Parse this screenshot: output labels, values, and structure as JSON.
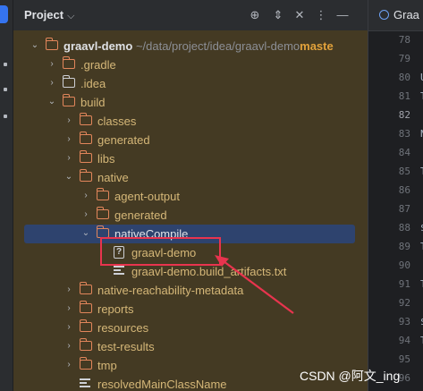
{
  "panel": {
    "title": "Project",
    "title_chevron": "⌵",
    "header_icons": [
      "crosshair-icon",
      "expand-collapse-icon",
      "collapse-all-icon",
      "more-options-icon",
      "hide-icon"
    ]
  },
  "tree": [
    {
      "depth": 0,
      "arrow": "⌄",
      "icon": "folder",
      "label": "graavl-demo",
      "path": "~/data/project/idea/graavl-demo",
      "branch": "maste",
      "style": "bold"
    },
    {
      "depth": 1,
      "arrow": "›",
      "icon": "folder",
      "label": ".gradle",
      "style": "orange"
    },
    {
      "depth": 1,
      "arrow": "›",
      "icon": "folder-white",
      "label": ".idea",
      "style": "orange"
    },
    {
      "depth": 1,
      "arrow": "⌄",
      "icon": "folder",
      "label": "build",
      "style": "orange"
    },
    {
      "depth": 2,
      "arrow": "›",
      "icon": "folder",
      "label": "classes",
      "style": "orange"
    },
    {
      "depth": 2,
      "arrow": "›",
      "icon": "folder",
      "label": "generated",
      "style": "orange"
    },
    {
      "depth": 2,
      "arrow": "›",
      "icon": "folder",
      "label": "libs",
      "style": "orange"
    },
    {
      "depth": 2,
      "arrow": "⌄",
      "icon": "folder",
      "label": "native",
      "style": "orange"
    },
    {
      "depth": 3,
      "arrow": "›",
      "icon": "folder",
      "label": "agent-output",
      "style": "orange"
    },
    {
      "depth": 3,
      "arrow": "›",
      "icon": "folder",
      "label": "generated",
      "style": "orange"
    },
    {
      "depth": 3,
      "arrow": "⌄",
      "icon": "folder",
      "label": "nativeCompile",
      "style": "white",
      "selected": true
    },
    {
      "depth": 4,
      "arrow": "",
      "icon": "unknown",
      "label": "graavl-demo",
      "style": "orange"
    },
    {
      "depth": 4,
      "arrow": "",
      "icon": "text",
      "label": "graavl-demo.build_artifacts.txt",
      "style": "orange"
    },
    {
      "depth": 2,
      "arrow": "›",
      "icon": "folder",
      "label": "native-reachability-metadata",
      "style": "orange"
    },
    {
      "depth": 2,
      "arrow": "›",
      "icon": "folder",
      "label": "reports",
      "style": "orange"
    },
    {
      "depth": 2,
      "arrow": "›",
      "icon": "folder",
      "label": "resources",
      "style": "orange"
    },
    {
      "depth": 2,
      "arrow": "›",
      "icon": "folder",
      "label": "test-results",
      "style": "orange"
    },
    {
      "depth": 2,
      "arrow": "›",
      "icon": "folder",
      "label": "tmp",
      "style": "orange"
    },
    {
      "depth": 2,
      "arrow": "",
      "icon": "text",
      "label": "resolvedMainClassName",
      "style": "orange"
    }
  ],
  "editor": {
    "tab_label": "Graa",
    "line_numbers": [
      "78",
      "79",
      "80",
      "81",
      "82",
      "83",
      "84",
      "85",
      "86",
      "87",
      "88",
      "89",
      "90",
      "91",
      "92",
      "93",
      "94",
      "95",
      "96"
    ],
    "current_line": "82",
    "gutter_letters": [
      "U",
      "T",
      "",
      "N",
      "",
      "T",
      "",
      "",
      "$",
      "T",
      "",
      "T",
      "",
      "$",
      "T"
    ]
  },
  "annotation": {
    "color": "#e8344e"
  },
  "watermark": "CSDN @阿文_ing"
}
